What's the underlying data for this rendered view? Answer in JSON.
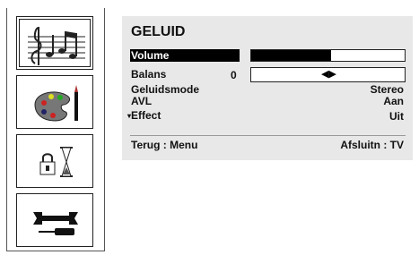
{
  "sidebar": {
    "items": [
      {
        "icon": "music-notes-icon",
        "selected": true
      },
      {
        "icon": "paint-palette-icon",
        "selected": false
      },
      {
        "icon": "lock-hourglass-icon",
        "selected": false
      },
      {
        "icon": "wrench-screwdriver-icon",
        "selected": false
      }
    ]
  },
  "menu": {
    "title": "GELUID",
    "volume": {
      "label": "Volume",
      "level_fraction": 0.52
    },
    "balans": {
      "label": "Balans",
      "value": "0",
      "arrows": "◀▶"
    },
    "geluidsmode": {
      "label": "Geluidsmode",
      "value": "Stereo"
    },
    "avl": {
      "label": "AVL",
      "value": "Aan"
    },
    "effect": {
      "marker": "▾",
      "label": "Effect",
      "value": "Uit"
    }
  },
  "footer": {
    "back": "Terug : Menu",
    "exit": "Afsluitn : TV"
  },
  "colors": {
    "panel_bg": "#e8e8e8",
    "highlight": "#000000"
  }
}
